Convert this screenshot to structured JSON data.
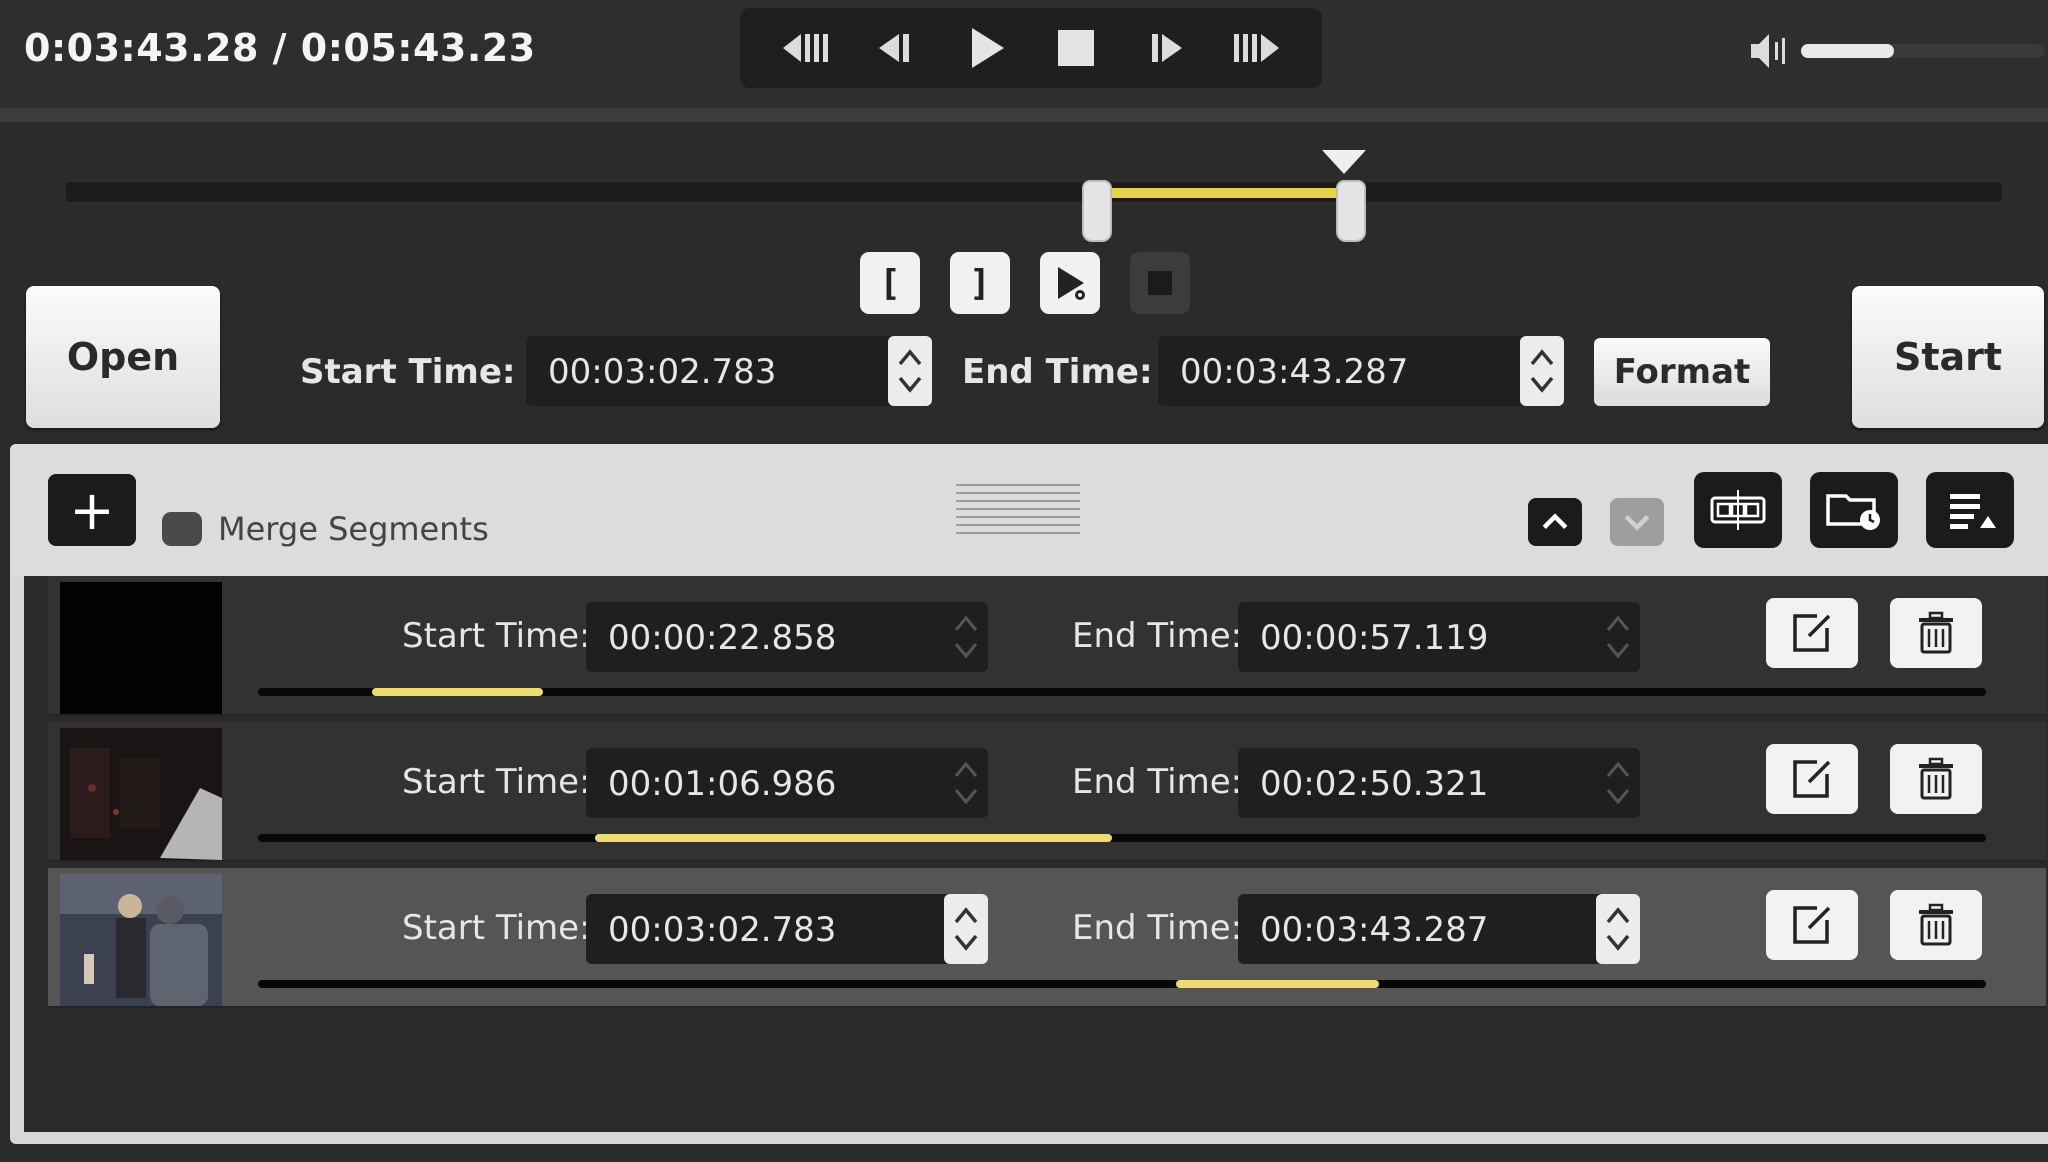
{
  "player": {
    "timecode": "0:03:43.28 / 0:05:43.23",
    "volume_fraction": 0.38,
    "transport": [
      {
        "name": "skip-start-icon"
      },
      {
        "name": "step-back-icon"
      },
      {
        "name": "play-icon"
      },
      {
        "name": "stop-icon"
      },
      {
        "name": "step-forward-icon"
      },
      {
        "name": "skip-end-icon"
      }
    ]
  },
  "trim": {
    "range_start_fraction": 0.535,
    "range_end_fraction": 0.66,
    "playhead_fraction": 0.66,
    "open_label": "Open",
    "start_label": "Start",
    "start_time_label": "Start Time:",
    "start_time_value": "00:03:02.783",
    "end_time_label": "End Time:",
    "end_time_value": "00:03:43.287",
    "format_label": "Format",
    "mini_buttons": [
      "[",
      "]"
    ]
  },
  "segments_toolbar": {
    "merge_label": "Merge Segments",
    "merge_checked": false
  },
  "segments": [
    {
      "start_label": "Start Time:",
      "start": "00:00:22.858",
      "end_label": "End Time:",
      "end": "00:00:57.119",
      "fill_from": 0.066,
      "fill_to": 0.165,
      "selected": false
    },
    {
      "start_label": "Start Time:",
      "start": "00:01:06.986",
      "end_label": "End Time:",
      "end": "00:02:50.321",
      "fill_from": 0.195,
      "fill_to": 0.494,
      "selected": false
    },
    {
      "start_label": "Start Time:",
      "start": "00:03:02.783",
      "end_label": "End Time:",
      "end": "00:03:43.287",
      "fill_from": 0.531,
      "fill_to": 0.649,
      "selected": true
    }
  ],
  "colors": {
    "accent": "#e6d24a",
    "panel": "#d8d8d8",
    "dark": "#2b2b2b"
  }
}
